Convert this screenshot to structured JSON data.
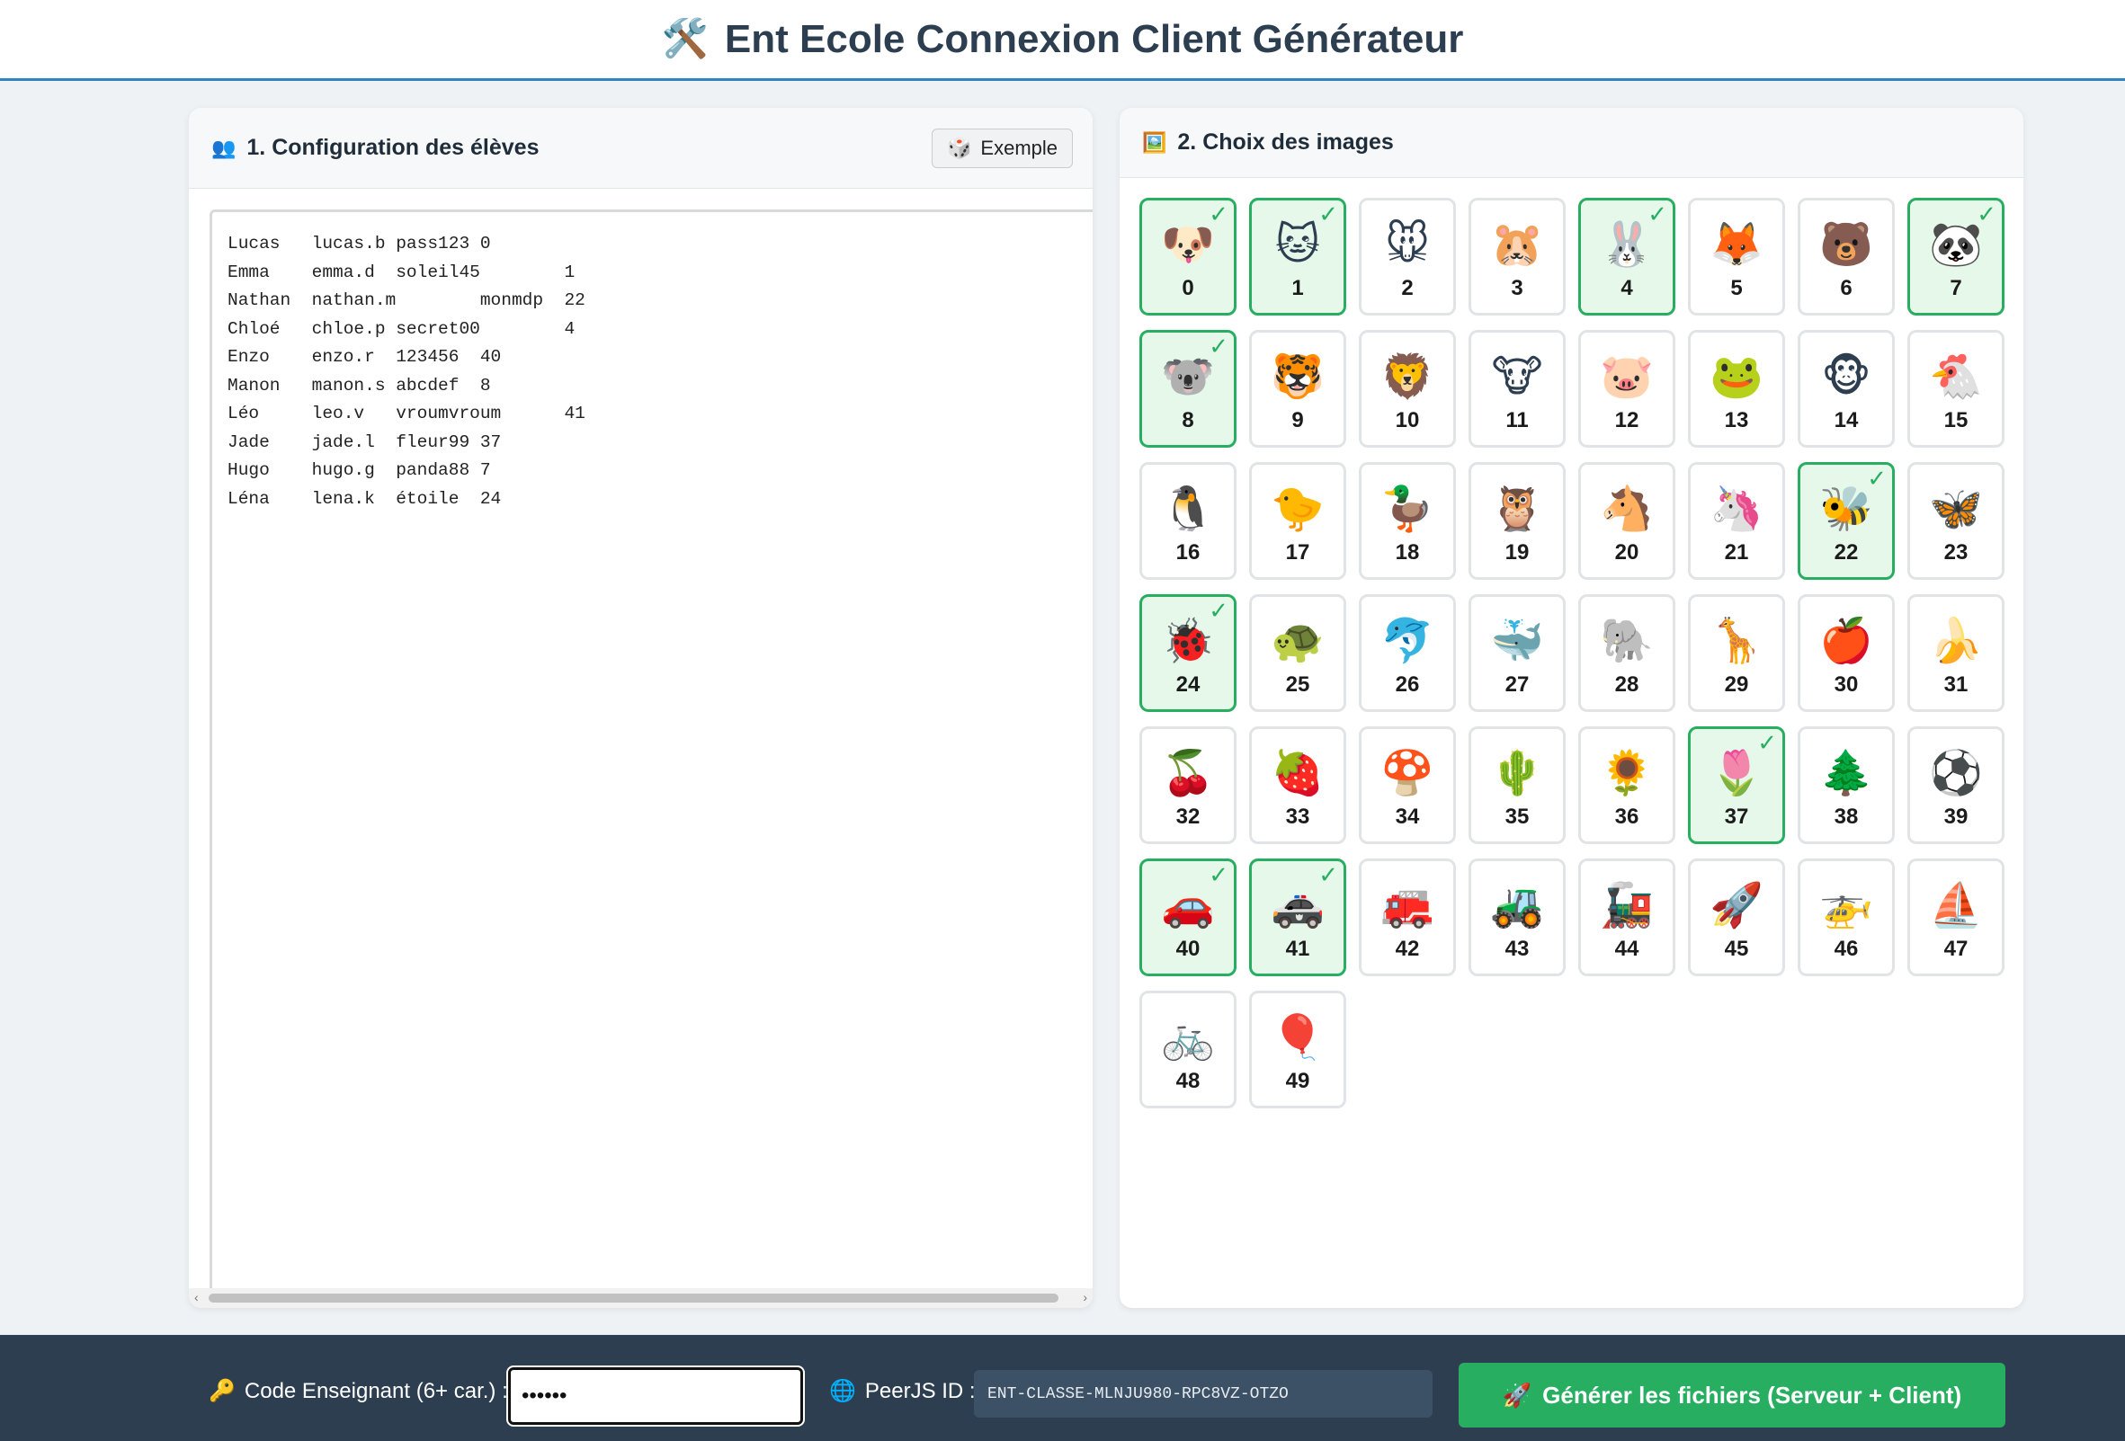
{
  "header": {
    "icon": "🛠️",
    "title": "Ent Ecole Connexion Client Générateur"
  },
  "students_panel": {
    "icon": "👥",
    "title": "1. Configuration des élèves",
    "example_button": {
      "icon": "🎲",
      "label": "Exemple"
    },
    "text": "Lucas\tlucas.b\tpass123\t0\nEmma\temma.d\tsoleil45\t1\nNathan\tnathan.m\tmonmdp\t22\nChloé\tchloe.p\tsecret00\t4\nEnzo\tenzo.r\t123456\t40\nManon\tmanon.s\tabcdef\t8\nLéo\tleo.v\tvroumvroum\t41\nJade\tjade.l\tfleur99\t37\nHugo\thugo.g\tpanda88\t7\nLéna\tlena.k\tétoile\t24"
  },
  "images_panel": {
    "icon": "🖼️",
    "title": "2. Choix des images",
    "check_mark": "✓",
    "items": [
      {
        "n": "0",
        "emoji": "🐶",
        "selected": true
      },
      {
        "n": "1",
        "emoji": "🐱",
        "selected": true
      },
      {
        "n": "2",
        "emoji": "🐭",
        "selected": false
      },
      {
        "n": "3",
        "emoji": "🐹",
        "selected": false
      },
      {
        "n": "4",
        "emoji": "🐰",
        "selected": true
      },
      {
        "n": "5",
        "emoji": "🦊",
        "selected": false
      },
      {
        "n": "6",
        "emoji": "🐻",
        "selected": false
      },
      {
        "n": "7",
        "emoji": "🐼",
        "selected": true
      },
      {
        "n": "8",
        "emoji": "🐨",
        "selected": true
      },
      {
        "n": "9",
        "emoji": "🐯",
        "selected": false
      },
      {
        "n": "10",
        "emoji": "🦁",
        "selected": false
      },
      {
        "n": "11",
        "emoji": "🐮",
        "selected": false
      },
      {
        "n": "12",
        "emoji": "🐷",
        "selected": false
      },
      {
        "n": "13",
        "emoji": "🐸",
        "selected": false
      },
      {
        "n": "14",
        "emoji": "🐵",
        "selected": false
      },
      {
        "n": "15",
        "emoji": "🐔",
        "selected": false
      },
      {
        "n": "16",
        "emoji": "🐧",
        "selected": false
      },
      {
        "n": "17",
        "emoji": "🐤",
        "selected": false
      },
      {
        "n": "18",
        "emoji": "🦆",
        "selected": false
      },
      {
        "n": "19",
        "emoji": "🦉",
        "selected": false
      },
      {
        "n": "20",
        "emoji": "🐴",
        "selected": false
      },
      {
        "n": "21",
        "emoji": "🦄",
        "selected": false
      },
      {
        "n": "22",
        "emoji": "🐝",
        "selected": true
      },
      {
        "n": "23",
        "emoji": "🦋",
        "selected": false
      },
      {
        "n": "24",
        "emoji": "🐞",
        "selected": true
      },
      {
        "n": "25",
        "emoji": "🐢",
        "selected": false
      },
      {
        "n": "26",
        "emoji": "🐬",
        "selected": false
      },
      {
        "n": "27",
        "emoji": "🐳",
        "selected": false
      },
      {
        "n": "28",
        "emoji": "🐘",
        "selected": false
      },
      {
        "n": "29",
        "emoji": "🦒",
        "selected": false
      },
      {
        "n": "30",
        "emoji": "🍎",
        "selected": false
      },
      {
        "n": "31",
        "emoji": "🍌",
        "selected": false
      },
      {
        "n": "32",
        "emoji": "🍒",
        "selected": false
      },
      {
        "n": "33",
        "emoji": "🍓",
        "selected": false
      },
      {
        "n": "34",
        "emoji": "🍄",
        "selected": false
      },
      {
        "n": "35",
        "emoji": "🌵",
        "selected": false
      },
      {
        "n": "36",
        "emoji": "🌻",
        "selected": false
      },
      {
        "n": "37",
        "emoji": "🌷",
        "selected": true
      },
      {
        "n": "38",
        "emoji": "🌲",
        "selected": false
      },
      {
        "n": "39",
        "emoji": "⚽",
        "selected": false
      },
      {
        "n": "40",
        "emoji": "🚗",
        "selected": true
      },
      {
        "n": "41",
        "emoji": "🚓",
        "selected": true
      },
      {
        "n": "42",
        "emoji": "🚒",
        "selected": false
      },
      {
        "n": "43",
        "emoji": "🚜",
        "selected": false
      },
      {
        "n": "44",
        "emoji": "🚂",
        "selected": false
      },
      {
        "n": "45",
        "emoji": "🚀",
        "selected": false
      },
      {
        "n": "46",
        "emoji": "🚁",
        "selected": false
      },
      {
        "n": "47",
        "emoji": "⛵",
        "selected": false
      },
      {
        "n": "48",
        "emoji": "🚲",
        "selected": false
      },
      {
        "n": "49",
        "emoji": "🎈",
        "selected": false
      }
    ]
  },
  "footer": {
    "code_label_icon": "🔑",
    "code_label": "Code Enseignant (6+ car.) :",
    "code_value": "••••••",
    "peer_label_icon": "🌐",
    "peer_label": "PeerJS ID :",
    "peer_value": "ENT-CLASSE-MLNJU980-RPC8VZ-OTZO",
    "generate_icon": "🚀",
    "generate_label": "Générer les fichiers (Serveur + Client)"
  },
  "colors": {
    "accent": "#2e86c1",
    "selected": "#27ae60",
    "footer": "#2c3e50"
  }
}
